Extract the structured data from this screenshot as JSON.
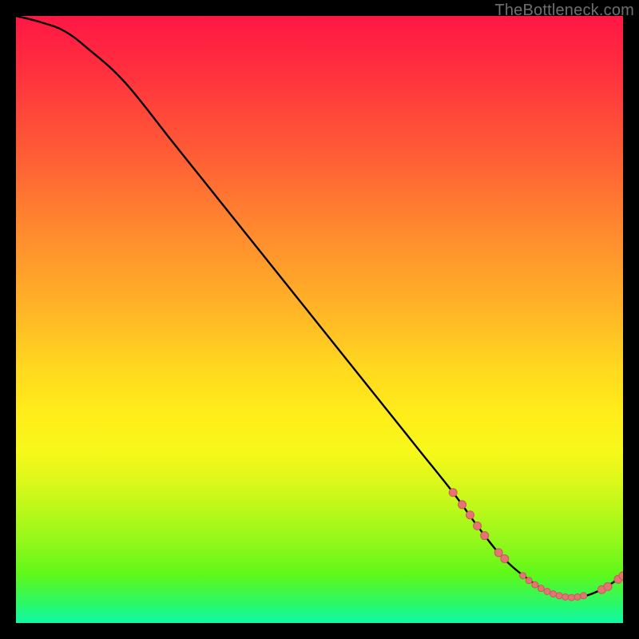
{
  "watermark": "TheBottleneck.com",
  "colors": {
    "curve": "#000000",
    "dot_fill": "#e57373",
    "dot_stroke": "#c85a5a"
  },
  "chart_data": {
    "type": "line",
    "title": "",
    "xlabel": "",
    "ylabel": "",
    "xlim": [
      0,
      100
    ],
    "ylim": [
      0,
      100
    ],
    "series": [
      {
        "name": "bottleneck-curve",
        "x": [
          0,
          4,
          8,
          12,
          18,
          26,
          34,
          42,
          50,
          58,
          66,
          72,
          76,
          80,
          84,
          88,
          92,
          96,
          100
        ],
        "y": [
          100,
          99,
          97.5,
          94.5,
          89,
          79,
          69,
          59,
          49,
          39,
          29,
          21.5,
          16,
          11,
          7.5,
          5,
          4.2,
          5.3,
          7.8
        ]
      }
    ],
    "dots": [
      {
        "name": "cluster-left-1",
        "x": 72.0,
        "y": 21.5,
        "r": 5
      },
      {
        "name": "cluster-left-2",
        "x": 73.5,
        "y": 19.5,
        "r": 5
      },
      {
        "name": "cluster-left-3",
        "x": 74.8,
        "y": 17.8,
        "r": 5
      },
      {
        "name": "cluster-left-4",
        "x": 76.0,
        "y": 16.0,
        "r": 5
      },
      {
        "name": "cluster-left-5",
        "x": 77.2,
        "y": 14.4,
        "r": 5
      },
      {
        "name": "gap-dot-1",
        "x": 79.5,
        "y": 11.6,
        "r": 5
      },
      {
        "name": "gap-dot-2",
        "x": 80.5,
        "y": 10.6,
        "r": 5
      },
      {
        "name": "bottom-1",
        "x": 83.5,
        "y": 7.8,
        "r": 4
      },
      {
        "name": "bottom-2",
        "x": 84.5,
        "y": 7.0,
        "r": 4
      },
      {
        "name": "bottom-3",
        "x": 85.5,
        "y": 6.3,
        "r": 4
      },
      {
        "name": "bottom-4",
        "x": 86.5,
        "y": 5.7,
        "r": 4
      },
      {
        "name": "bottom-5",
        "x": 87.5,
        "y": 5.2,
        "r": 4
      },
      {
        "name": "bottom-6",
        "x": 88.5,
        "y": 4.8,
        "r": 4
      },
      {
        "name": "bottom-7",
        "x": 89.5,
        "y": 4.5,
        "r": 4
      },
      {
        "name": "bottom-8",
        "x": 90.5,
        "y": 4.3,
        "r": 4
      },
      {
        "name": "bottom-9",
        "x": 91.5,
        "y": 4.2,
        "r": 4
      },
      {
        "name": "bottom-10",
        "x": 92.5,
        "y": 4.3,
        "r": 4
      },
      {
        "name": "bottom-11",
        "x": 93.5,
        "y": 4.5,
        "r": 4
      },
      {
        "name": "right-1",
        "x": 96.5,
        "y": 5.5,
        "r": 5
      },
      {
        "name": "right-2",
        "x": 97.5,
        "y": 6.0,
        "r": 5
      },
      {
        "name": "right-end-1",
        "x": 99.2,
        "y": 7.2,
        "r": 5
      },
      {
        "name": "right-end-2",
        "x": 100.0,
        "y": 7.8,
        "r": 5
      }
    ]
  }
}
